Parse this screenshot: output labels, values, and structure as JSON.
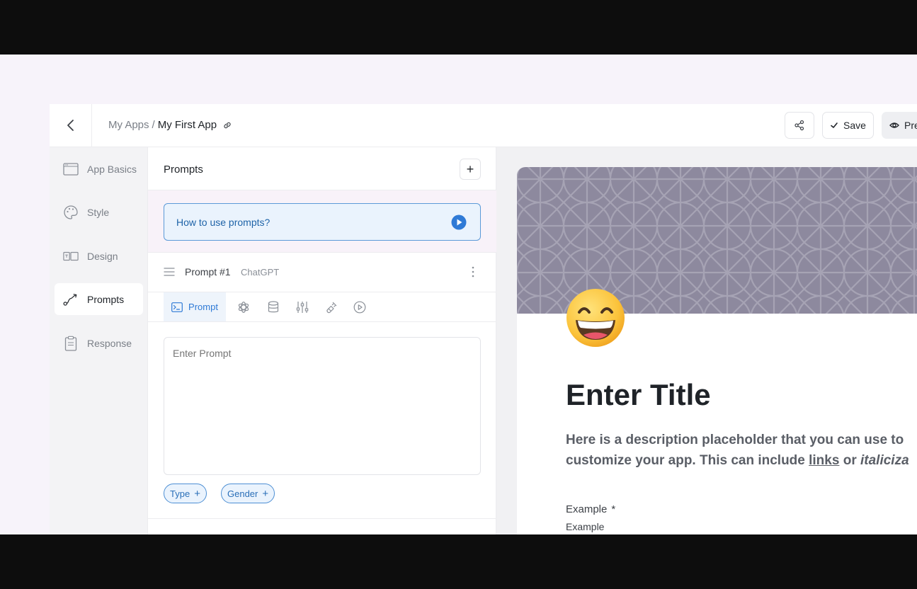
{
  "header": {
    "breadcrumb_parent": "My Apps",
    "breadcrumb_separator": "/",
    "breadcrumb_current": "My First App",
    "save_label": "Save",
    "preview_label": "Pre"
  },
  "sidebar": {
    "items": [
      {
        "label": "App Basics",
        "icon": "browser-window-icon",
        "active": false
      },
      {
        "label": "Style",
        "icon": "palette-icon",
        "active": false
      },
      {
        "label": "Design",
        "icon": "layout-icon",
        "active": false
      },
      {
        "label": "Prompts",
        "icon": "flow-path-icon",
        "active": true
      },
      {
        "label": "Response",
        "icon": "clipboard-icon",
        "active": false
      }
    ]
  },
  "prompts_panel": {
    "title": "Prompts",
    "add_label": "+",
    "help_text": "How to use prompts?",
    "prompt_name": "Prompt #1",
    "prompt_model": "ChatGPT",
    "tabs": [
      {
        "label": "Prompt",
        "icon": "terminal-icon",
        "active": true
      },
      {
        "label": "",
        "icon": "openai-icon",
        "active": false
      },
      {
        "label": "",
        "icon": "database-icon",
        "active": false
      },
      {
        "label": "",
        "icon": "sliders-icon",
        "active": false
      },
      {
        "label": "",
        "icon": "plug-icon",
        "active": false
      },
      {
        "label": "",
        "icon": "play-circle-icon",
        "active": false
      }
    ],
    "prompt_placeholder": "Enter Prompt",
    "variables": [
      {
        "label": "Type"
      },
      {
        "label": "Gender"
      }
    ]
  },
  "preview": {
    "emoji": "grinning-face",
    "title": "Enter Title",
    "description_line1": "Here is a description placeholder that you can use to",
    "description_line2_a": "customize your app. This can include ",
    "description_link": "links",
    "description_line2_b": " or ",
    "description_italic": "italiciza",
    "field_label": "Example",
    "field_required": "*",
    "field_placeholder": "Example"
  },
  "colors": {
    "accent_blue": "#2f7ad6",
    "help_bg": "#eaf3fd",
    "banner": "#8d899e",
    "stage_bg": "#f7f3fa"
  }
}
